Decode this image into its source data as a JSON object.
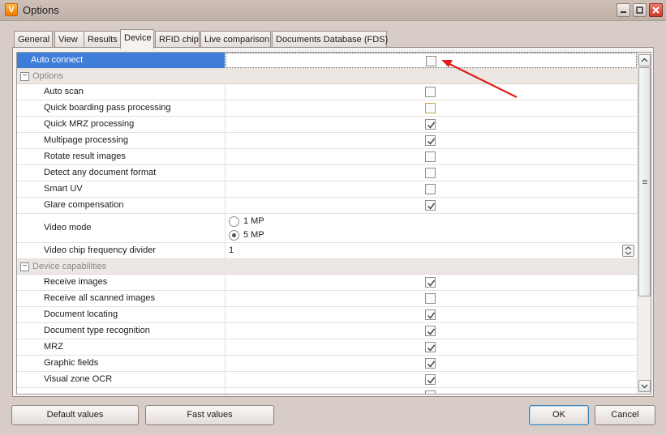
{
  "window": {
    "title": "Options",
    "app_icon_glyph": "V",
    "controls": [
      "minimize-icon",
      "maximize-icon",
      "close-icon"
    ]
  },
  "tabs": [
    {
      "label": "General",
      "active": false
    },
    {
      "label": "View",
      "active": false
    },
    {
      "label": "Results",
      "active": false
    },
    {
      "label": "Device",
      "active": true
    },
    {
      "label": "RFID chip",
      "active": false
    },
    {
      "label": "Live comparison",
      "active": false
    },
    {
      "label": "Documents Database (FDS)",
      "active": false
    }
  ],
  "grid": {
    "top_row": {
      "label": "Auto connect",
      "checked": false,
      "selected": true
    },
    "options": {
      "category": "Options",
      "rows": [
        {
          "label": "Auto scan",
          "checked": false
        },
        {
          "label": "Quick boarding pass processing",
          "checked": false,
          "hot": true
        },
        {
          "label": "Quick MRZ processing",
          "checked": true
        },
        {
          "label": "Multipage processing",
          "checked": true
        },
        {
          "label": "Rotate result images",
          "checked": false
        },
        {
          "label": "Detect any document format",
          "checked": false
        },
        {
          "label": "Smart UV",
          "checked": false
        },
        {
          "label": "Glare compensation",
          "checked": true
        }
      ],
      "video_mode": {
        "label": "Video mode",
        "options": [
          {
            "label": "1 MP",
            "checked": false
          },
          {
            "label": "5 MP",
            "checked": true
          }
        ]
      },
      "frequency": {
        "label": "Video chip frequency divider",
        "value": "1"
      }
    },
    "capabilities": {
      "category": "Device capabilities",
      "rows": [
        {
          "label": "Receive images",
          "checked": true
        },
        {
          "label": "Receive all scanned images",
          "checked": false
        },
        {
          "label": "Document locating",
          "checked": true
        },
        {
          "label": "Document type recognition",
          "checked": true
        },
        {
          "label": "MRZ",
          "checked": true
        },
        {
          "label": "Graphic fields",
          "checked": true
        },
        {
          "label": "Visual zone OCR",
          "checked": true
        }
      ]
    }
  },
  "buttons": {
    "default_values": "Default values",
    "fast_values": "Fast values",
    "ok": "OK",
    "cancel": "Cancel"
  },
  "colors": {
    "selection": "#3e7dd8",
    "annotation_arrow": "#e0201c"
  }
}
